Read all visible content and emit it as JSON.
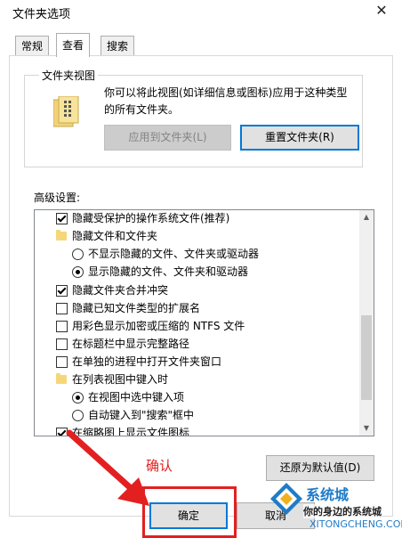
{
  "window": {
    "title": "文件夹选项"
  },
  "tabs": [
    {
      "label": "常规",
      "active": false
    },
    {
      "label": "查看",
      "active": true
    },
    {
      "label": "搜索",
      "active": false
    }
  ],
  "folder_views": {
    "group_label": "文件夹视图",
    "description": "你可以将此视图(如详细信息或图标)应用于这种类型的所有文件夹。",
    "apply_label": "应用到文件夹(L)",
    "reset_label": "重置文件夹(R)"
  },
  "advanced": {
    "label": "高级设置:",
    "items": [
      {
        "kind": "check",
        "checked": true,
        "indent": 0,
        "label": "隐藏受保护的操作系统文件(推荐)"
      },
      {
        "kind": "folder",
        "checked": false,
        "indent": 0,
        "label": "隐藏文件和文件夹"
      },
      {
        "kind": "radio",
        "checked": false,
        "indent": 1,
        "label": "不显示隐藏的文件、文件夹或驱动器"
      },
      {
        "kind": "radio",
        "checked": true,
        "indent": 1,
        "label": "显示隐藏的文件、文件夹和驱动器"
      },
      {
        "kind": "check",
        "checked": true,
        "indent": 0,
        "label": "隐藏文件夹合并冲突"
      },
      {
        "kind": "check",
        "checked": false,
        "indent": 0,
        "label": "隐藏已知文件类型的扩展名"
      },
      {
        "kind": "check",
        "checked": false,
        "indent": 0,
        "label": "用彩色显示加密或压缩的 NTFS 文件"
      },
      {
        "kind": "check",
        "checked": false,
        "indent": 0,
        "label": "在标题栏中显示完整路径"
      },
      {
        "kind": "check",
        "checked": false,
        "indent": 0,
        "label": "在单独的进程中打开文件夹窗口"
      },
      {
        "kind": "folder",
        "checked": false,
        "indent": 0,
        "label": "在列表视图中键入时"
      },
      {
        "kind": "radio",
        "checked": true,
        "indent": 1,
        "label": "在视图中选中键入项"
      },
      {
        "kind": "radio",
        "checked": false,
        "indent": 1,
        "label": "自动键入到\"搜索\"框中"
      },
      {
        "kind": "check",
        "checked": true,
        "indent": 0,
        "label": "在缩略图上显示文件图标"
      }
    ],
    "restore_label": "还原为默认值(D)"
  },
  "footer": {
    "ok_label": "确定",
    "cancel_label": "取消"
  },
  "annotation": {
    "text": "确认",
    "color": "#e32020"
  },
  "watermark": {
    "brand": "系统城",
    "slogan": "你的身边的系统城",
    "domain": "XITONGCHENG.COM"
  }
}
